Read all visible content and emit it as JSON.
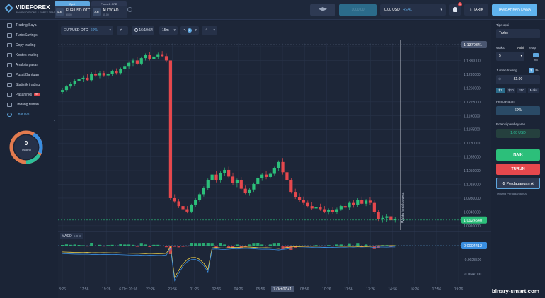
{
  "logo": {
    "name": "VIDEFOREX",
    "tagline": "BINARY OPTIONS & FOREX TRADING"
  },
  "asset_tabs": [
    {
      "header": "Opsi",
      "flag": "EUR",
      "name": "EUR/USD OTC",
      "pct": "60.00",
      "active": true
    },
    {
      "header": "Forex & CFD",
      "flag": "AUD",
      "name": "AUD/CAD",
      "pct": "60.00",
      "active": false
    }
  ],
  "topbar": {
    "balance": "0.00 USD",
    "account_type": "REAL",
    "tarik_label": "TARIK",
    "deposit_label": "TAMBAHKAN DANA",
    "notification_count": "1",
    "blurred_field": "1000.00"
  },
  "sidebar": {
    "items": [
      {
        "label": "Trading Saya"
      },
      {
        "label": "TurboSavings"
      },
      {
        "label": "Copy trading"
      },
      {
        "label": "Kontes trading"
      },
      {
        "label": "Analisis pasar"
      },
      {
        "label": "Pusat Bantuan"
      },
      {
        "label": "Statistik trading"
      },
      {
        "label": "Pasarlinks",
        "badge": "99"
      },
      {
        "label": "Undang teman"
      },
      {
        "label": "Chat live",
        "active": true
      }
    ],
    "trading_count": "0",
    "trading_label": "Trading"
  },
  "toolbar": {
    "pair": "EUR/USD OTC",
    "pair_pct": "60%",
    "time": "16:10:54",
    "timeframe": "15m",
    "indicator_count": "1"
  },
  "chart_data": {
    "type": "candlestick",
    "y_ticks": [
      "1.1365000",
      "1.1330000",
      "1.1295000",
      "1.1260000",
      "1.1225000",
      "1.1190000",
      "1.1155000",
      "1.1120000",
      "1.1085000",
      "1.1050000",
      "1.1015000",
      "1.0980000",
      "1.0945000",
      "1.0910000"
    ],
    "ylim": [
      1.0899,
      1.1374
    ],
    "x_ticks": [
      "8:26",
      "17:56",
      "19:26",
      "6 Oct 20:56",
      "22:26",
      "23:56",
      "01:26",
      "02:56",
      "04:26",
      "05:56",
      "7 Oct 07:41",
      "08:56",
      "10:26",
      "11:56",
      "13:26",
      "14:56",
      "16:26",
      "17:56",
      "19:26"
    ],
    "current_price": "1.0924540",
    "crosshair_price": "1.1370341",
    "highlight_x": "7 Oct 07:41",
    "vertical_label": "Waktu kedaluwarsa",
    "candles": [
      [
        1.125,
        1.126,
        1.1245,
        1.1255
      ],
      [
        1.1255,
        1.1268,
        1.125,
        1.1264
      ],
      [
        1.1264,
        1.1275,
        1.1258,
        1.127
      ],
      [
        1.127,
        1.1282,
        1.1265,
        1.1278
      ],
      [
        1.1278,
        1.1288,
        1.127,
        1.1283
      ],
      [
        1.1283,
        1.1292,
        1.1275,
        1.1286
      ],
      [
        1.1286,
        1.1295,
        1.1278,
        1.128
      ],
      [
        1.128,
        1.13,
        1.1276,
        1.1296
      ],
      [
        1.1296,
        1.1305,
        1.1288,
        1.1292
      ],
      [
        1.1292,
        1.1302,
        1.1285,
        1.1298
      ],
      [
        1.1298,
        1.1304,
        1.1288,
        1.1292
      ],
      [
        1.1292,
        1.13,
        1.1284,
        1.1296
      ],
      [
        1.1296,
        1.1306,
        1.129,
        1.1302
      ],
      [
        1.1302,
        1.131,
        1.1294,
        1.1298
      ],
      [
        1.1298,
        1.1312,
        1.1294,
        1.1308
      ],
      [
        1.1308,
        1.132,
        1.13,
        1.1316
      ],
      [
        1.1316,
        1.1328,
        1.1308,
        1.1324
      ],
      [
        1.1324,
        1.1335,
        1.1316,
        1.133
      ],
      [
        1.133,
        1.1338,
        1.1318,
        1.1322
      ],
      [
        1.1322,
        1.134,
        1.1318,
        1.1336
      ],
      [
        1.1336,
        1.1348,
        1.133,
        1.1344
      ],
      [
        1.1344,
        1.1352,
        1.133,
        1.1334
      ],
      [
        1.1334,
        1.1345,
        1.1326,
        1.134
      ],
      [
        1.134,
        1.135,
        1.1334,
        1.1346
      ],
      [
        1.1346,
        1.1354,
        1.1338,
        1.1341
      ],
      [
        1.1341,
        1.1348,
        1.1325,
        1.133
      ],
      [
        1.133,
        1.0985,
        1.0975,
        1.098
      ],
      [
        1.098,
        1.099,
        1.0968,
        1.0972
      ],
      [
        1.0972,
        1.0978,
        1.0955,
        1.096
      ],
      [
        1.096,
        1.0968,
        1.0948,
        1.0952
      ],
      [
        1.0952,
        1.096,
        1.0942,
        1.0946
      ],
      [
        1.0946,
        1.0966,
        1.0942,
        1.0962
      ],
      [
        1.0962,
        1.098,
        1.0958,
        1.0976
      ],
      [
        1.0976,
        1.0995,
        1.097,
        1.099
      ],
      [
        1.099,
        1.101,
        1.0984,
        1.1006
      ],
      [
        1.1006,
        1.103,
        1.1,
        1.1026
      ],
      [
        1.1026,
        1.1045,
        1.1018,
        1.104
      ],
      [
        1.104,
        1.105,
        1.102,
        1.1025
      ],
      [
        1.1025,
        1.1048,
        1.102,
        1.1044
      ],
      [
        1.1044,
        1.1058,
        1.1036,
        1.1052
      ],
      [
        1.1052,
        1.106,
        1.103,
        1.1035
      ],
      [
        1.1035,
        1.1045,
        1.1014,
        1.1018
      ],
      [
        1.1018,
        1.103,
        1.1008,
        1.1026
      ],
      [
        1.1026,
        1.1034,
        1.1,
        1.1004
      ],
      [
        1.1004,
        1.1012,
        1.099,
        1.0994
      ],
      [
        1.0994,
        1.1006,
        1.0986,
        1.1002
      ],
      [
        1.1002,
        1.102,
        1.0996,
        1.1016
      ],
      [
        1.1016,
        1.1036,
        1.101,
        1.1032
      ],
      [
        1.1032,
        1.1044,
        1.1024,
        1.104
      ],
      [
        1.104,
        1.105,
        1.1028,
        1.1034
      ],
      [
        1.1034,
        1.1046,
        1.103,
        1.1042
      ],
      [
        1.1042,
        1.106,
        1.1038,
        1.1056
      ],
      [
        1.1056,
        1.1076,
        1.105,
        1.1072
      ],
      [
        1.1072,
        1.1082,
        1.104,
        1.1046
      ],
      [
        1.1046,
        1.1056,
        1.102,
        1.1026
      ],
      [
        1.1026,
        1.1032,
        1.0992,
        1.0996
      ],
      [
        1.0996,
        1.1004,
        1.0978,
        1.0982
      ],
      [
        1.0982,
        1.0992,
        1.097,
        1.0976
      ],
      [
        1.0976,
        1.0984,
        1.0964,
        1.0968
      ],
      [
        1.0968,
        1.0974,
        1.0956,
        1.096
      ],
      [
        1.096,
        1.097,
        1.095,
        1.0954
      ],
      [
        1.0954,
        1.0962,
        1.0944,
        1.0958
      ],
      [
        1.0958,
        1.0966,
        1.0948,
        1.0952
      ],
      [
        1.0952,
        1.096,
        1.0942,
        1.0946
      ],
      [
        1.0946,
        1.0954,
        1.0938,
        1.095
      ],
      [
        1.095,
        1.0958,
        1.094,
        1.0944
      ],
      [
        1.0944,
        1.0956,
        1.094,
        1.0952
      ],
      [
        1.0952,
        1.0964,
        1.0948,
        1.096
      ],
      [
        1.096,
        1.097,
        1.0952,
        1.0956
      ],
      [
        1.0956,
        1.0972,
        1.095,
        1.0968
      ],
      [
        1.0968,
        1.0976,
        1.0956,
        1.0962
      ],
      [
        1.0962,
        1.098,
        1.0958,
        1.0976
      ],
      [
        1.0976,
        1.0984,
        1.0962,
        1.0966
      ],
      [
        1.0966,
        1.0978,
        1.096,
        1.0974
      ],
      [
        1.0974,
        1.0982,
        1.0962,
        1.0968
      ],
      [
        1.0968,
        1.0976,
        1.094,
        1.0944
      ],
      [
        1.0944,
        1.095,
        1.0922,
        1.0926
      ],
      [
        1.0926,
        1.0936,
        1.0918,
        1.093
      ],
      [
        1.093,
        1.094,
        1.092,
        1.0934
      ],
      [
        1.0934,
        1.0938,
        1.0918,
        1.0924
      ],
      [
        1.0924,
        1.0932,
        1.0918,
        1.0926
      ]
    ]
  },
  "macd": {
    "label": "MACD",
    "params": "5 8 3",
    "value": "0.0004412",
    "y_ticks": [
      "-0.0023500",
      "-0.0047000"
    ]
  },
  "panel": {
    "option_type_label": "Tipe opsi",
    "option_type": "Turbo",
    "time_label": "Waktu",
    "time_mode_a": "Akhir",
    "time_mode_b": "Tetap",
    "time_value": "5",
    "time_unit": "min",
    "amount_label": "Jumlah trading",
    "amount_mode_a": "$",
    "amount_mode_b": "%",
    "amount": "$1.00",
    "presets": [
      "$1",
      "$10",
      "$50",
      "Maks"
    ],
    "payout_label": "Pembayaran",
    "payout": "60%",
    "potential_label": "Potensi pembayaran",
    "potential": "1.60 USD",
    "up_label": "NAIK",
    "down_label": "TURUN",
    "ai_label": "Perdagangan AI",
    "ai_about": "Tentang Perdagangan AI"
  },
  "watermark": "binary-smart.com"
}
